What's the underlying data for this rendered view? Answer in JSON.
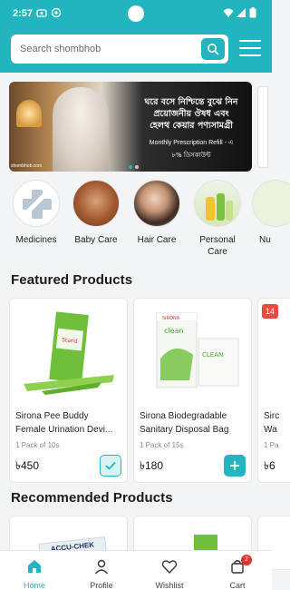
{
  "status_bar": {
    "time": "2:57"
  },
  "search": {
    "placeholder": "Search shombhob"
  },
  "banner": {
    "logo_text": "shombhob.com",
    "line1": "ঘরে বসে নিশ্চিন্তে বুঝে নিন",
    "line2": "প্রয়োজনীয় ঔষধ এবং",
    "line3": "হেলথ কেয়ার পণ্যসামগ্রী",
    "line4": "Monthly Prescription Refill - এ",
    "line5": "৮% ডিসকাউন্ট"
  },
  "categories": [
    {
      "label": "Medicines"
    },
    {
      "label": "Baby Care"
    },
    {
      "label": "Hair Care"
    },
    {
      "label": "Personal Care"
    },
    {
      "label": "Nu"
    }
  ],
  "featured": {
    "title": "Featured Products",
    "products": [
      {
        "name_line1": "Sirona Pee Buddy",
        "name_line2": "Female Urination Devi...",
        "pack": "1 Pack of 10s",
        "price": "৳450",
        "state": "added"
      },
      {
        "name_line1": "Sirona Biodegradable",
        "name_line2": "Sanitary Disposal Bag",
        "pack": "1 Pack of 15s",
        "price": "৳180",
        "state": "add"
      },
      {
        "name_line1": "Sirc",
        "name_line2": "Wa",
        "pack": "1 Pa",
        "price": "৳6",
        "discount": "14"
      }
    ]
  },
  "recommended": {
    "title": "Recommended Products",
    "product1_brand": "ACCU-CHEK"
  },
  "bottom_nav": {
    "items": [
      {
        "label": "Home",
        "active": true
      },
      {
        "label": "Profile"
      },
      {
        "label": "Wishlist"
      },
      {
        "label": "Cart",
        "badge": "2"
      }
    ]
  },
  "colors": {
    "accent": "#23b5bf",
    "badge": "#e0352b"
  }
}
